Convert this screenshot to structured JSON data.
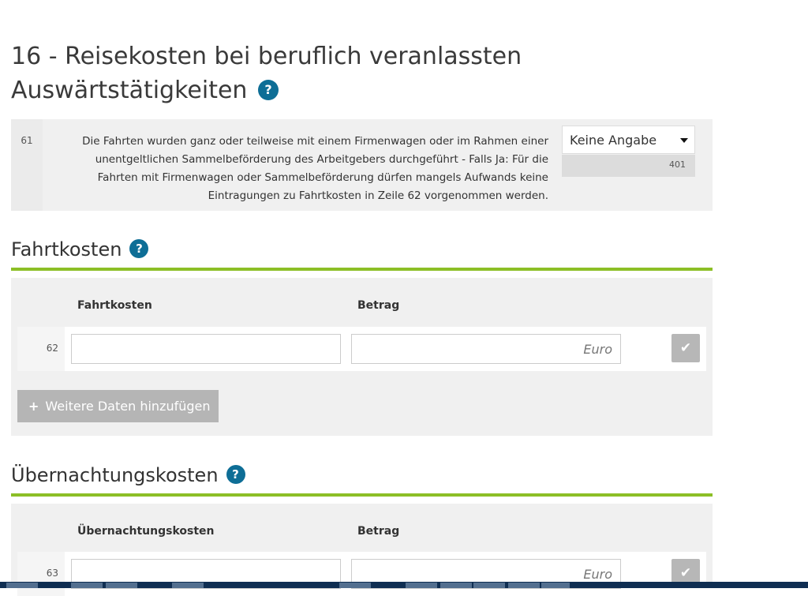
{
  "page": {
    "title": "16 - Reisekosten bei beruflich veranlassten Auswärtstätigkeiten",
    "help_glyph": "?"
  },
  "question61": {
    "line_number": "61",
    "text": "Die Fahrten wurden ganz oder teilweise mit einem Firmenwagen oder im Rahmen einer unentgeltlichen Sammelbeförderung des Arbeitgebers durchgeführt - Falls Ja: Für die Fahrten mit Firmenwagen oder Sammelbeförderung dürfen mangels Aufwands keine Eintragungen zu Fahrtkosten in Zeile 62 vorgenommen werden.",
    "selected_value": "Keine Angabe",
    "field_code": "401"
  },
  "fahrtkosten": {
    "heading": "Fahrtkosten",
    "col_description": "Fahrtkosten",
    "col_amount": "Betrag",
    "row_line": "62",
    "description_value": "",
    "amount_unit": "Euro",
    "add_button_label": "Weitere Daten hinzufügen",
    "add_button_plus": "+"
  },
  "uebernachtungskosten": {
    "heading": "Übernachtungskosten",
    "col_description": "Übernachtungskosten",
    "col_amount": "Betrag",
    "row_line": "63",
    "description_value": "",
    "amount_unit": "Euro"
  },
  "icons": {
    "check": "✔",
    "accent_green": "#8cbf26",
    "help_blue": "#0e6e96"
  }
}
